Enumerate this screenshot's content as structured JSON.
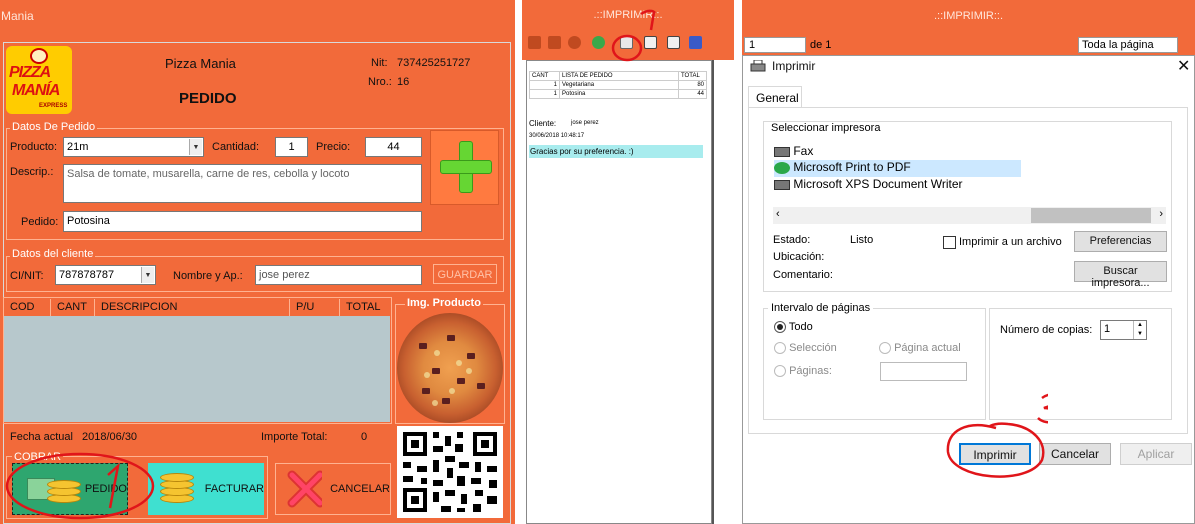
{
  "app": {
    "title": "Mania"
  },
  "form": {
    "store_name": "Pizza Mania",
    "heading": "PEDIDO",
    "nit_label": "Nit:",
    "nit_value": "737425251727",
    "nro_label": "Nro.:",
    "nro_value": "16",
    "logo": {
      "line1": "PIZZA",
      "line2": "MANÍA",
      "line3": "EXPRESS"
    },
    "order_group": {
      "title": "Datos De Pedido",
      "producto_label": "Producto:",
      "producto_value": "21m",
      "cantidad_label": "Cantidad:",
      "cantidad_value": "1",
      "precio_label": "Precio:",
      "precio_value": "44",
      "descrip_label": "Descrip.:",
      "descrip_value": "Salsa de tomate, musarella, carne de res, cebolla y locoto",
      "pedido_label": "Pedido:",
      "pedido_value": "Potosina"
    },
    "client_group": {
      "title": "Datos del cliente",
      "ci_label": "CI/NIT:",
      "ci_value": "787878787",
      "nombre_label": "Nombre y Ap.:",
      "nombre_value": "jose perez",
      "guardar_label": "GUARDAR"
    },
    "grid": {
      "columns": [
        "COD",
        "CANT",
        "DESCRIPCION",
        "P/U",
        "TOTAL"
      ]
    },
    "img_title": "Img. Producto",
    "fecha_label": "Fecha actual",
    "fecha_value": "2018/06/30",
    "importe_label": "Importe Total:",
    "importe_value": "0",
    "cobrar_label": "COBRAR",
    "pedido_button": "PEDIDO",
    "facturar_button": "FACTURAR",
    "cancelar_button": "CANCELAR"
  },
  "preview": {
    "title": ".::IMPRIMIR::.",
    "table_headers": [
      "CANT",
      "LISTA DE PEDIDO",
      "TOTAL"
    ],
    "rows": [
      {
        "cant": "1",
        "item": "Vegetariana",
        "total": "80"
      },
      {
        "cant": "1",
        "item": "Potosina",
        "total": "44"
      }
    ],
    "cliente_label": "Cliente:",
    "cliente_value": "jose perez",
    "datetime": "30/06/2018 10:48:17",
    "thanks": "Gracias por su preferencia. :)"
  },
  "print_window": {
    "title": ".::IMPRIMIR::.",
    "page_value": "1",
    "page_of": "de 1",
    "zoom_value": "Toda la página"
  },
  "print_dialog": {
    "title": "Imprimir",
    "tab": "General",
    "select_printer_label": "Seleccionar impresora",
    "printers": [
      "Fax",
      "Microsoft Print to PDF",
      "Microsoft XPS Document Writer"
    ],
    "selected_printer_index": 1,
    "estado_label": "Estado:",
    "estado_value": "Listo",
    "ubicacion_label": "Ubicación:",
    "comentario_label": "Comentario:",
    "print_to_file_label": "Imprimir a un archivo",
    "preferences_button": "Preferencias",
    "find_printer_button": "Buscar impresora...",
    "page_range_title": "Intervalo de páginas",
    "todo_label": "Todo",
    "seleccion_label": "Selección",
    "pagina_actual_label": "Página actual",
    "paginas_label": "Páginas:",
    "copies_label": "Número de copias:",
    "copies_value": "1",
    "print_button": "Imprimir",
    "cancel_button": "Cancelar",
    "apply_button": "Aplicar"
  },
  "annotations": {
    "mark1": "1",
    "mark2": "1",
    "mark3": "3"
  },
  "colors": {
    "form_bg": "#f26a3a",
    "accent": "#0078d7",
    "annotation": "#e0151a"
  }
}
